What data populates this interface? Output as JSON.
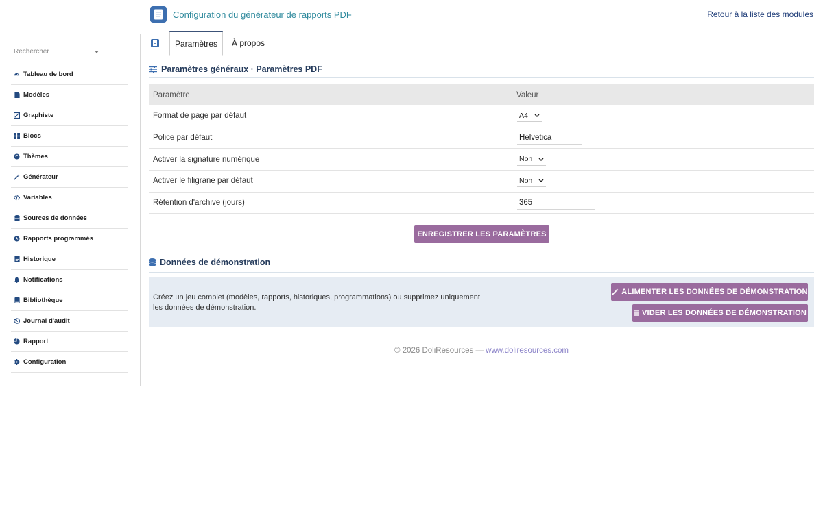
{
  "header": {
    "title": "Configuration du générateur de rapports PDF",
    "back_link": "Retour à la liste des modules"
  },
  "sidebar": {
    "search_placeholder": "Rechercher",
    "items": [
      {
        "label": "Tableau de bord",
        "icon": "dashboard-icon"
      },
      {
        "label": "Modèles",
        "icon": "file-icon"
      },
      {
        "label": "Graphiste",
        "icon": "design-icon"
      },
      {
        "label": "Blocs",
        "icon": "blocks-icon"
      },
      {
        "label": "Thèmes",
        "icon": "palette-icon"
      },
      {
        "label": "Générateur",
        "icon": "magic-wand-icon"
      },
      {
        "label": "Variables",
        "icon": "code-icon"
      },
      {
        "label": "Sources de données",
        "icon": "database-icon"
      },
      {
        "label": "Rapports programmés",
        "icon": "clock-icon"
      },
      {
        "label": "Historique",
        "icon": "history-doc-icon"
      },
      {
        "label": "Notifications",
        "icon": "bell-icon"
      },
      {
        "label": "Bibliothèque",
        "icon": "book-icon"
      },
      {
        "label": "Journal d'audit",
        "icon": "undo-history-icon"
      },
      {
        "label": "Rapport",
        "icon": "pie-chart-icon"
      },
      {
        "label": "Configuration",
        "icon": "gear-icon"
      }
    ]
  },
  "tabs": {
    "settings": "Paramètres",
    "about": "À propos"
  },
  "params_section": {
    "title": "Paramètres généraux · Paramètres PDF",
    "col_param": "Paramètre",
    "col_value": "Valeur",
    "rows": [
      {
        "label": "Format de page par défaut",
        "value": "A4"
      },
      {
        "label": "Police par défaut",
        "value": "Helvetica"
      },
      {
        "label": "Activer la signature numérique",
        "value": "Non"
      },
      {
        "label": "Activer le filigrane par défaut",
        "value": "Non"
      },
      {
        "label": "Rétention d'archive (jours)",
        "value": "365"
      }
    ],
    "save_label": "ENREGISTRER LES PARAMÈTRES"
  },
  "demo_section": {
    "title": "Données de démonstration",
    "description": "Créez un jeu complet (modèles, rapports, historiques, programmations) ou supprimez uniquement les données de démonstration.",
    "seed_label": "ALIMENTER LES DONNÉES DE DÉMONSTRATION",
    "clear_label": "VIDER LES DONNÉES DE DÉMONSTRATION"
  },
  "footer": {
    "copyright": "© 2026 DoliResources —",
    "link": "www.doliresources.com"
  },
  "colors": {
    "accent_title": "#2f8a9d",
    "button": "#9a6b9e",
    "section_title": "#263c5c",
    "icon_blue": "#3d6fb0"
  }
}
